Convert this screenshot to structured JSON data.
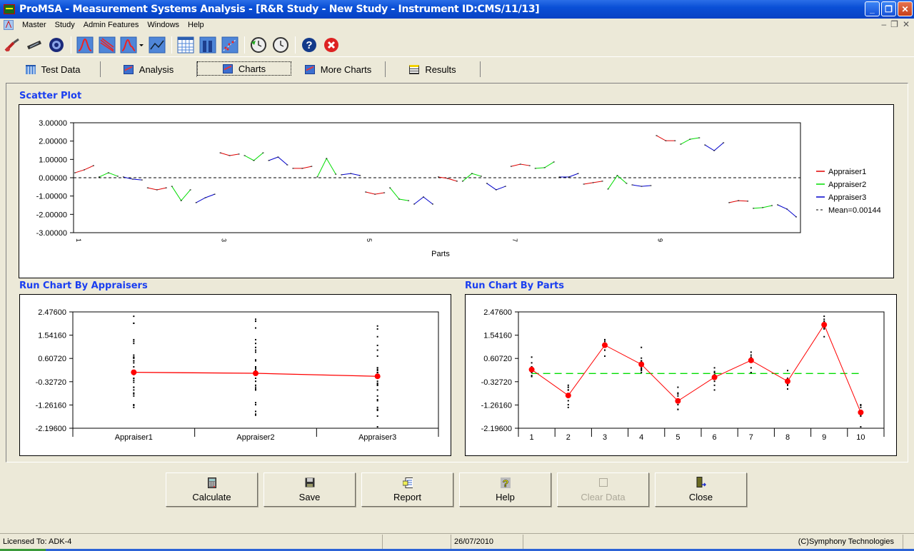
{
  "window": {
    "title": "ProMSA - Measurement Systems Analysis - [R&R Study - New Study - Instrument ID:CMS/11/13]",
    "controls": [
      "minimize",
      "restore",
      "close"
    ]
  },
  "menubar": {
    "items": [
      "Master",
      "Study",
      "Admin Features",
      "Windows",
      "Help"
    ],
    "mdi_controls": [
      "minimize",
      "restore",
      "close"
    ]
  },
  "toolbar": {
    "buttons": [
      {
        "name": "micrometer-icon"
      },
      {
        "name": "caliper-icon"
      },
      {
        "name": "gauge-ring-icon"
      },
      {
        "name": "normal-distribution-icon"
      },
      {
        "name": "regression-lines-icon"
      },
      {
        "name": "distribution-dropdown-icon"
      },
      {
        "name": "line-chart-icon"
      },
      {
        "name": "data-grid-icon"
      },
      {
        "name": "bar-chart-icon"
      },
      {
        "name": "scatter-chart-icon"
      },
      {
        "name": "history-back-icon"
      },
      {
        "name": "clock-icon"
      },
      {
        "name": "help-icon"
      },
      {
        "name": "exit-icon"
      }
    ]
  },
  "tabs": [
    {
      "label": "Test Data",
      "icon": "grid",
      "active": false
    },
    {
      "label": "Analysis",
      "icon": "chart",
      "active": false
    },
    {
      "label": "Charts",
      "icon": "chart",
      "active": true
    },
    {
      "label": "More Charts",
      "icon": "chart",
      "active": false
    },
    {
      "label": "Results",
      "icon": "results",
      "active": false
    }
  ],
  "sections": {
    "scatter": "Scatter Plot",
    "run_appraisers": "Run Chart By Appraisers",
    "run_parts": "Run Chart By Parts"
  },
  "colors": {
    "appraiser1": "#e00000",
    "appraiser2": "#00dd00",
    "appraiser3": "#0000cc",
    "mean_line": "#000000",
    "run_line": "#ff0000",
    "grand_mean_line": "#00dd00",
    "section_title": "#1a3ef0"
  },
  "chart_data": [
    {
      "type": "line",
      "title": "Scatter Plot",
      "xlabel": "Parts",
      "ylabel": "",
      "ylim": [
        -3,
        3
      ],
      "yticks": [
        "3.00000",
        "2.00000",
        "1.00000",
        "0.00000",
        "-1.00000",
        "-2.00000",
        "-3.00000"
      ],
      "ytick_values": [
        3,
        2,
        1,
        0,
        -1,
        -2,
        -3
      ],
      "xtick_labels": [
        "1",
        "3",
        "5",
        "7",
        "9"
      ],
      "parts": [
        1,
        2,
        3,
        4,
        5,
        6,
        7,
        8,
        9,
        10
      ],
      "legend_position": "right",
      "mean": {
        "label": "Mean=0.00144",
        "value": 0.00144
      },
      "series": [
        {
          "name": "Appraiser1",
          "color": "#e00000",
          "trials_by_part": [
            [
              0.27,
              0.43,
              0.66
            ],
            [
              -0.55,
              -0.66,
              -0.55
            ],
            [
              1.36,
              1.21,
              1.29
            ],
            [
              0.51,
              0.51,
              0.62
            ],
            [
              -0.78,
              -0.9,
              -0.82
            ],
            [
              0.04,
              -0.04,
              -0.19
            ],
            [
              0.62,
              0.74,
              0.66
            ],
            [
              -0.35,
              -0.27,
              -0.19
            ],
            [
              2.3,
              2.02,
              2.02
            ],
            [
              -1.36,
              -1.25,
              -1.28
            ]
          ]
        },
        {
          "name": "Appraiser2",
          "color": "#00dd00",
          "trials_by_part": [
            [
              0.04,
              0.27,
              0.08
            ],
            [
              -0.47,
              -1.25,
              -0.66
            ],
            [
              1.21,
              0.94,
              1.36
            ],
            [
              0.04,
              1.05,
              0.19
            ],
            [
              -0.55,
              -1.17,
              -1.25
            ],
            [
              -0.19,
              0.23,
              0.08
            ],
            [
              0.51,
              0.55,
              0.86
            ],
            [
              -0.62,
              0.12,
              -0.31
            ],
            [
              1.83,
              2.1,
              2.18
            ],
            [
              -1.67,
              -1.63,
              -1.52
            ]
          ]
        },
        {
          "name": "Appraiser3",
          "color": "#0000cc",
          "trials_by_part": [
            [
              0.04,
              -0.08,
              -0.12
            ],
            [
              -1.36,
              -1.09,
              -0.9
            ],
            [
              0.94,
              1.13,
              0.7
            ],
            [
              0.16,
              0.23,
              0.12
            ],
            [
              -1.44,
              -1.05,
              -1.44
            ],
            [
              -0.31,
              -0.66,
              -0.47
            ],
            [
              0.04,
              0.04,
              0.23
            ],
            [
              -0.39,
              -0.47,
              -0.43
            ],
            [
              1.79,
              1.48,
              1.91
            ],
            [
              -1.48,
              -1.71,
              -2.14
            ]
          ]
        }
      ]
    },
    {
      "type": "line",
      "title": "Run Chart By Appraisers",
      "xlabel": "",
      "ylabel": "",
      "ylim": [
        -2.196,
        2.476
      ],
      "yticks": [
        "2.47600",
        "1.54160",
        "0.60720",
        "-0.32720",
        "-1.26160",
        "-2.19600"
      ],
      "ytick_values": [
        2.476,
        1.5416,
        0.6072,
        -0.3272,
        -1.2616,
        -2.196
      ],
      "categories": [
        "Appraiser1",
        "Appraiser2",
        "Appraiser3"
      ],
      "means": [
        0.05,
        0.01,
        -0.11
      ],
      "points_per_category": "all trials of each appraiser (from scatter series)"
    },
    {
      "type": "line",
      "title": "Run Chart By Parts",
      "xlabel": "",
      "ylabel": "",
      "ylim": [
        -2.196,
        2.476
      ],
      "yticks": [
        "2.47600",
        "1.54160",
        "0.60720",
        "-0.32720",
        "-1.26160",
        "-2.19600"
      ],
      "ytick_values": [
        2.476,
        1.5416,
        0.6072,
        -0.3272,
        -1.2616,
        -2.196
      ],
      "categories": [
        "1",
        "2",
        "3",
        "4",
        "5",
        "6",
        "7",
        "8",
        "9",
        "10"
      ],
      "means": [
        0.16,
        -0.88,
        1.14,
        0.37,
        -1.1,
        -0.15,
        0.53,
        -0.31,
        1.96,
        -1.56
      ],
      "grand_mean": 0.00144
    }
  ],
  "buttons": [
    {
      "label": "Calculate",
      "icon": "calculator-icon",
      "enabled": true
    },
    {
      "label": "Save",
      "icon": "floppy-disk-icon",
      "enabled": true
    },
    {
      "label": "Report",
      "icon": "report-icon",
      "enabled": true
    },
    {
      "label": "Help",
      "icon": "help-icon",
      "enabled": true
    },
    {
      "label": "Clear Data",
      "icon": "clear-icon",
      "enabled": false
    },
    {
      "label": "Close",
      "icon": "exit-door-icon",
      "enabled": true
    }
  ],
  "statusbar": {
    "license": "Licensed To: ADK-4",
    "empty": "",
    "date": "26/07/2010",
    "copyright": "(C)Symphony Technologies"
  }
}
